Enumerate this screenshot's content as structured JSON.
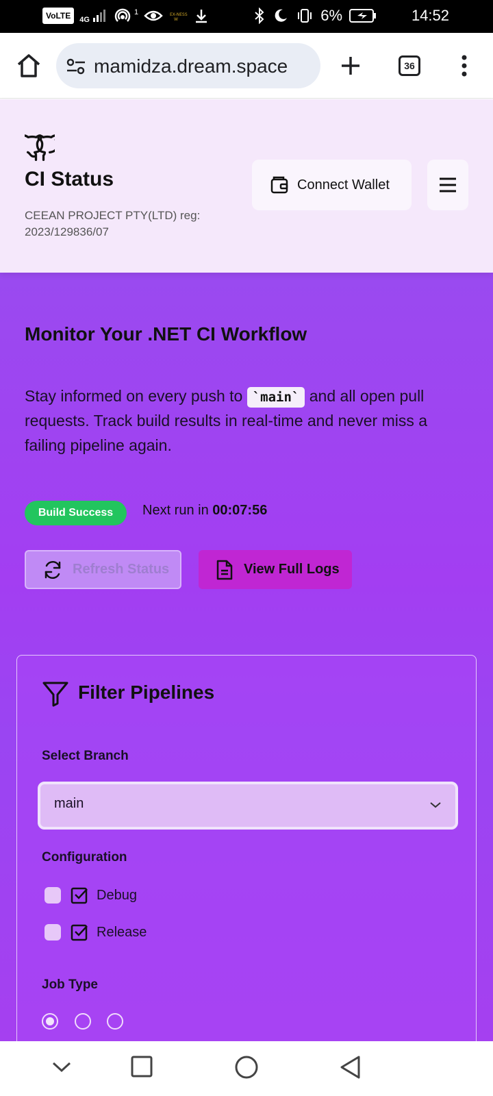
{
  "status_bar": {
    "volte": "VoLTE",
    "network": "4G",
    "hotspot_count": "1",
    "battery": "6%",
    "time": "14:52"
  },
  "browser": {
    "url": "mamidza.dream.space",
    "tab_count": "36"
  },
  "header": {
    "title": "CI Status",
    "subtitle": "CEEAN PROJECT PTY(LTD) reg: 2023/129836/07",
    "connect_wallet": "Connect Wallet"
  },
  "hero": {
    "title": "Monitor Your .NET CI Workflow",
    "text_before": "Stay informed on every push to ",
    "code": "`main`",
    "text_after": " and all open pull requests. Track build results in real-time and never miss a failing pipeline again.",
    "badge": "Build Success",
    "next_run_label": "Next run in ",
    "next_run_value": "00:07:56",
    "refresh_label": "Refresh Status",
    "logs_label": "View Full Logs"
  },
  "filter": {
    "title": "Filter Pipelines",
    "branch_label": "Select Branch",
    "branch_value": "main",
    "config_label": "Configuration",
    "config_options": [
      "Debug",
      "Release"
    ],
    "job_label": "Job Type",
    "job_selected_index": 0
  },
  "colors": {
    "accent": "#c026d3",
    "success": "#22c55e",
    "header_bg": "#f5e8fb",
    "main_bg": "#a33ef2"
  }
}
